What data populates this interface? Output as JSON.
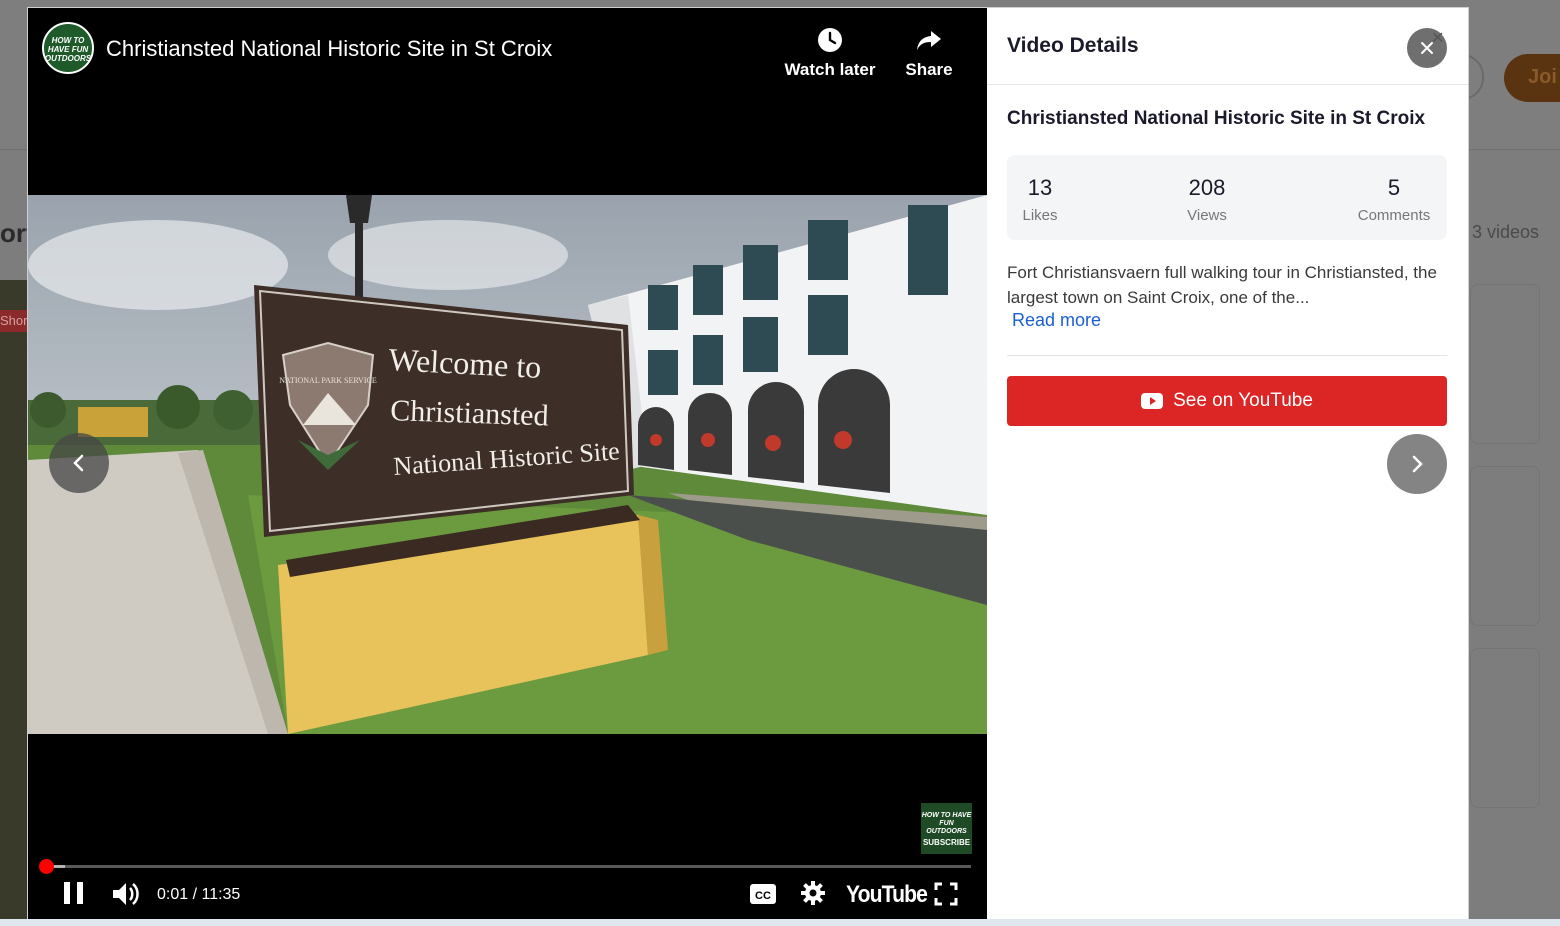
{
  "background": {
    "join_label": "Joi",
    "videos_count": "3 videos",
    "left_tag": "Shor",
    "left_text": "ort"
  },
  "player": {
    "channel_logo_text": "HOW TO HAVE FUN OUTDOORS",
    "title": "Christiansted National Historic Site in St Croix",
    "watch_later_label": "Watch later",
    "share_label": "Share",
    "sign": {
      "line1": "Welcome to",
      "line2": "Christiansted",
      "line3": "National Historic Site",
      "emblem_text": "NATIONAL PARK SERVICE"
    },
    "watermark_text": "HOW TO HAVE FUN OUTDOORS",
    "watermark_subscribe": "SUBSCRIBE",
    "time_readout": "0:01 / 11:35",
    "progress_played_fraction": 0.0015,
    "progress_loaded_fraction": 0.022,
    "youtube_logo": "YouTube",
    "icons": {
      "watch_later": "clock-icon",
      "share": "share-arrow-icon",
      "pause": "pause-icon",
      "volume": "volume-icon",
      "captions": "cc-icon",
      "settings": "gear-icon",
      "fullscreen": "fullscreen-icon",
      "prev": "chevron-left-icon",
      "next": "chevron-right-icon",
      "close": "close-icon",
      "youtube": "youtube-play-icon"
    }
  },
  "details": {
    "heading": "Video Details",
    "title": "Christiansted National Historic Site in St Croix",
    "stats": {
      "likes_value": "13",
      "likes_label": "Likes",
      "views_value": "208",
      "views_label": "Views",
      "comments_value": "5",
      "comments_label": "Comments"
    },
    "description": "Fort Christiansvaern full walking tour in Christiansted, the largest town on Saint Croix, one of the...",
    "read_more": "Read more",
    "youtube_button": "See on YouTube"
  },
  "colors": {
    "youtube_red": "#dc2626",
    "progress_red": "#ff0000",
    "link_blue": "#1a5fd0",
    "overlay_gray": "#7d7d7d"
  }
}
